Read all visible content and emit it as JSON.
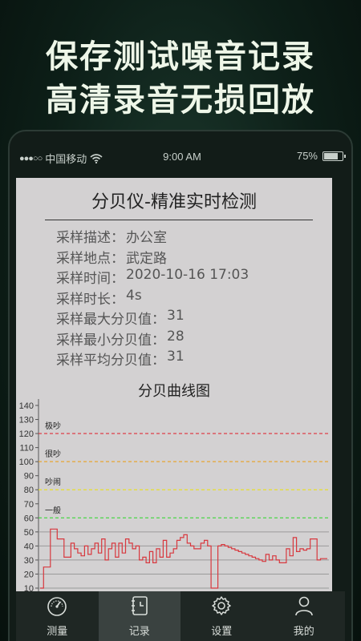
{
  "promo": {
    "line1": "保存测试噪音记录",
    "line2": "高清录音无损回放"
  },
  "status_bar": {
    "carrier": "中国移动",
    "time": "9:00 AM",
    "battery": "75%",
    "battery_level": 0.75
  },
  "report": {
    "title": "分贝仪-精准实时检测",
    "fields": [
      {
        "label": "采样描述：",
        "value": "办公室"
      },
      {
        "label": "采样地点：",
        "value": "武定路"
      },
      {
        "label": "采样时间：",
        "value": "2020-10-16 17:03"
      },
      {
        "label": "采样时长：",
        "value": "4s"
      },
      {
        "label": "采样最大分贝值：",
        "value": "31"
      },
      {
        "label": "采样最小分贝值：",
        "value": "28"
      },
      {
        "label": "采样平均分贝值：",
        "value": "31"
      }
    ],
    "chart_title": "分贝曲线图"
  },
  "chart_data": {
    "type": "line",
    "title": "分贝曲线图",
    "y_ticks": [
      140,
      130,
      120,
      110,
      100,
      90,
      80,
      70,
      60,
      50,
      40,
      30,
      20,
      10
    ],
    "ylim": [
      10,
      140
    ],
    "thresholds": [
      {
        "value": 120,
        "label": "极吵",
        "color": "#e0303a"
      },
      {
        "value": 100,
        "label": "很吵",
        "color": "#e8a531"
      },
      {
        "value": 80,
        "label": "吵闹",
        "color": "#e8e02a"
      },
      {
        "value": 60,
        "label": "一般",
        "color": "#3dd63a"
      }
    ],
    "series": [
      {
        "color": "#d8383e",
        "values": [
          10,
          25,
          25,
          52,
          52,
          45,
          45,
          32,
          32,
          42,
          38,
          35,
          33,
          40,
          34,
          38,
          42,
          35,
          45,
          30,
          38,
          42,
          32,
          42,
          35,
          45,
          42,
          38,
          40,
          30,
          32,
          28,
          36,
          28,
          38,
          32,
          44,
          32,
          35,
          38,
          44,
          46,
          48,
          42,
          40,
          38,
          38,
          42,
          44,
          40,
          10,
          10,
          40,
          41,
          40,
          39,
          38,
          37,
          36,
          35,
          34,
          33,
          32,
          31,
          30,
          29,
          34,
          30,
          33,
          30,
          28,
          28,
          38,
          33,
          46,
          36,
          38,
          37,
          38,
          45,
          45,
          30,
          31,
          31
        ]
      }
    ],
    "grid": true
  },
  "tabs": [
    {
      "label": "测量",
      "icon": "speedometer-icon",
      "active": false
    },
    {
      "label": "记录",
      "icon": "record-book-icon",
      "active": true
    },
    {
      "label": "设置",
      "icon": "gear-icon",
      "active": false
    },
    {
      "label": "我的",
      "icon": "user-icon",
      "active": false
    }
  ]
}
